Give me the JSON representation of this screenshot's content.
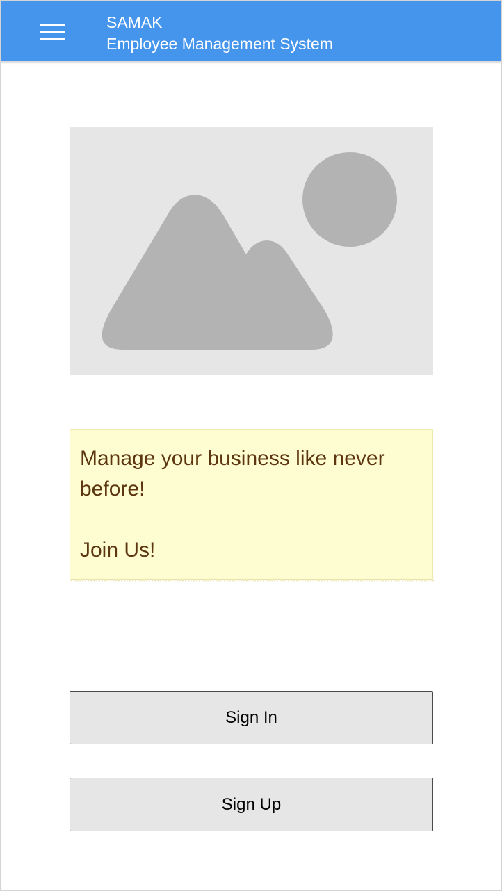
{
  "app_bar": {
    "brand": "SAMAK",
    "subtitle": "Employee Management System",
    "menu_icon": "hamburger-menu-icon",
    "background_color": "#4695ec"
  },
  "hero": {
    "image_icon": "image-placeholder-icon"
  },
  "note": {
    "line1": "Manage your business like never before!",
    "line2": "Join Us!",
    "background_color": "#fefcd1",
    "text_color": "#5c3610"
  },
  "actions": {
    "sign_in_label": "Sign In",
    "sign_up_label": "Sign Up"
  }
}
